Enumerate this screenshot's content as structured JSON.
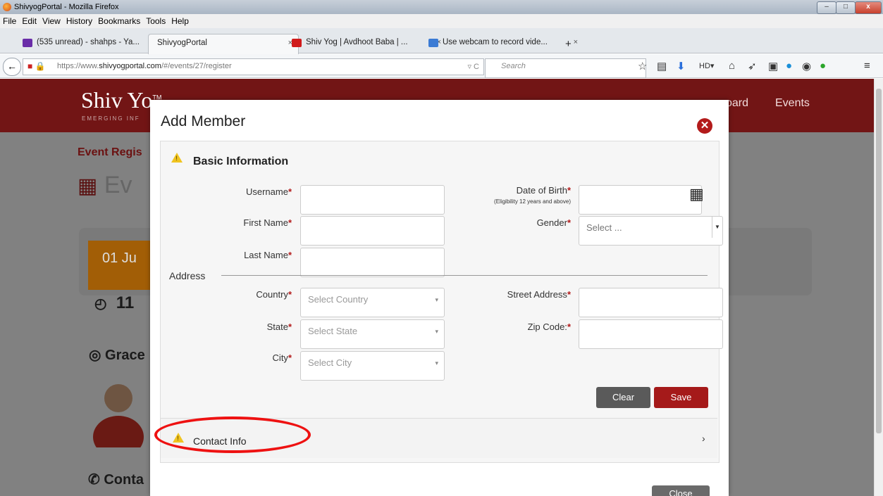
{
  "window": {
    "title": "ShivyogPortal - Mozilla Firefox"
  },
  "menu": [
    "File",
    "Edit",
    "View",
    "History",
    "Bookmarks",
    "Tools",
    "Help"
  ],
  "tabs": [
    {
      "label": "(535 unread) - shahps - Ya...",
      "close": "×",
      "icon_color": "#6a2da8"
    },
    {
      "label": "ShivyogPortal",
      "close": "×",
      "active": true
    },
    {
      "label": "Shiv Yog | Avdhoot Baba | ...",
      "close": "×",
      "icon_color": "#d01b1b"
    },
    {
      "label": "Use webcam to record vide...",
      "close": "×",
      "icon_color": "#3b7bd4"
    }
  ],
  "new_tab": "+",
  "url": {
    "prefix": "https://www.",
    "domain": "shivyogportal.com",
    "path": "/#/events/27/register"
  },
  "search_placeholder": "Search",
  "site": {
    "logo": "Shiv Yo",
    "logo_tm": "TM",
    "tagline": "EMERGING INF",
    "nav": [
      "oard",
      "Events"
    ],
    "event_registration": "Event Regis",
    "event_title": "Ev",
    "date_badge": "01  Ju",
    "time_fragment": "11",
    "grace_label": "Grace",
    "contact_label": "Conta"
  },
  "modal": {
    "title": "Add Member",
    "basic_section": "Basic Information",
    "fields": {
      "username": "Username",
      "first_name": "First Name",
      "last_name": "Last Name",
      "dob": "Date of Birth",
      "dob_note": "(Eligibility 12 years and above)",
      "gender": "Gender",
      "gender_placeholder": "Select ...",
      "address_heading": "Address",
      "country": "Country",
      "country_placeholder": "Select Country",
      "state": "State",
      "state_placeholder": "Select State",
      "city": "City",
      "city_placeholder": "Select City",
      "street": "Street Address",
      "zip": "Zip Code:"
    },
    "clear": "Clear",
    "save": "Save",
    "contact_section": "Contact Info",
    "close": "Close"
  },
  "colors": {
    "accent": "#721515",
    "save": "#a51a1a",
    "clear": "#5a5a5a",
    "highlight": "#ee1111"
  }
}
